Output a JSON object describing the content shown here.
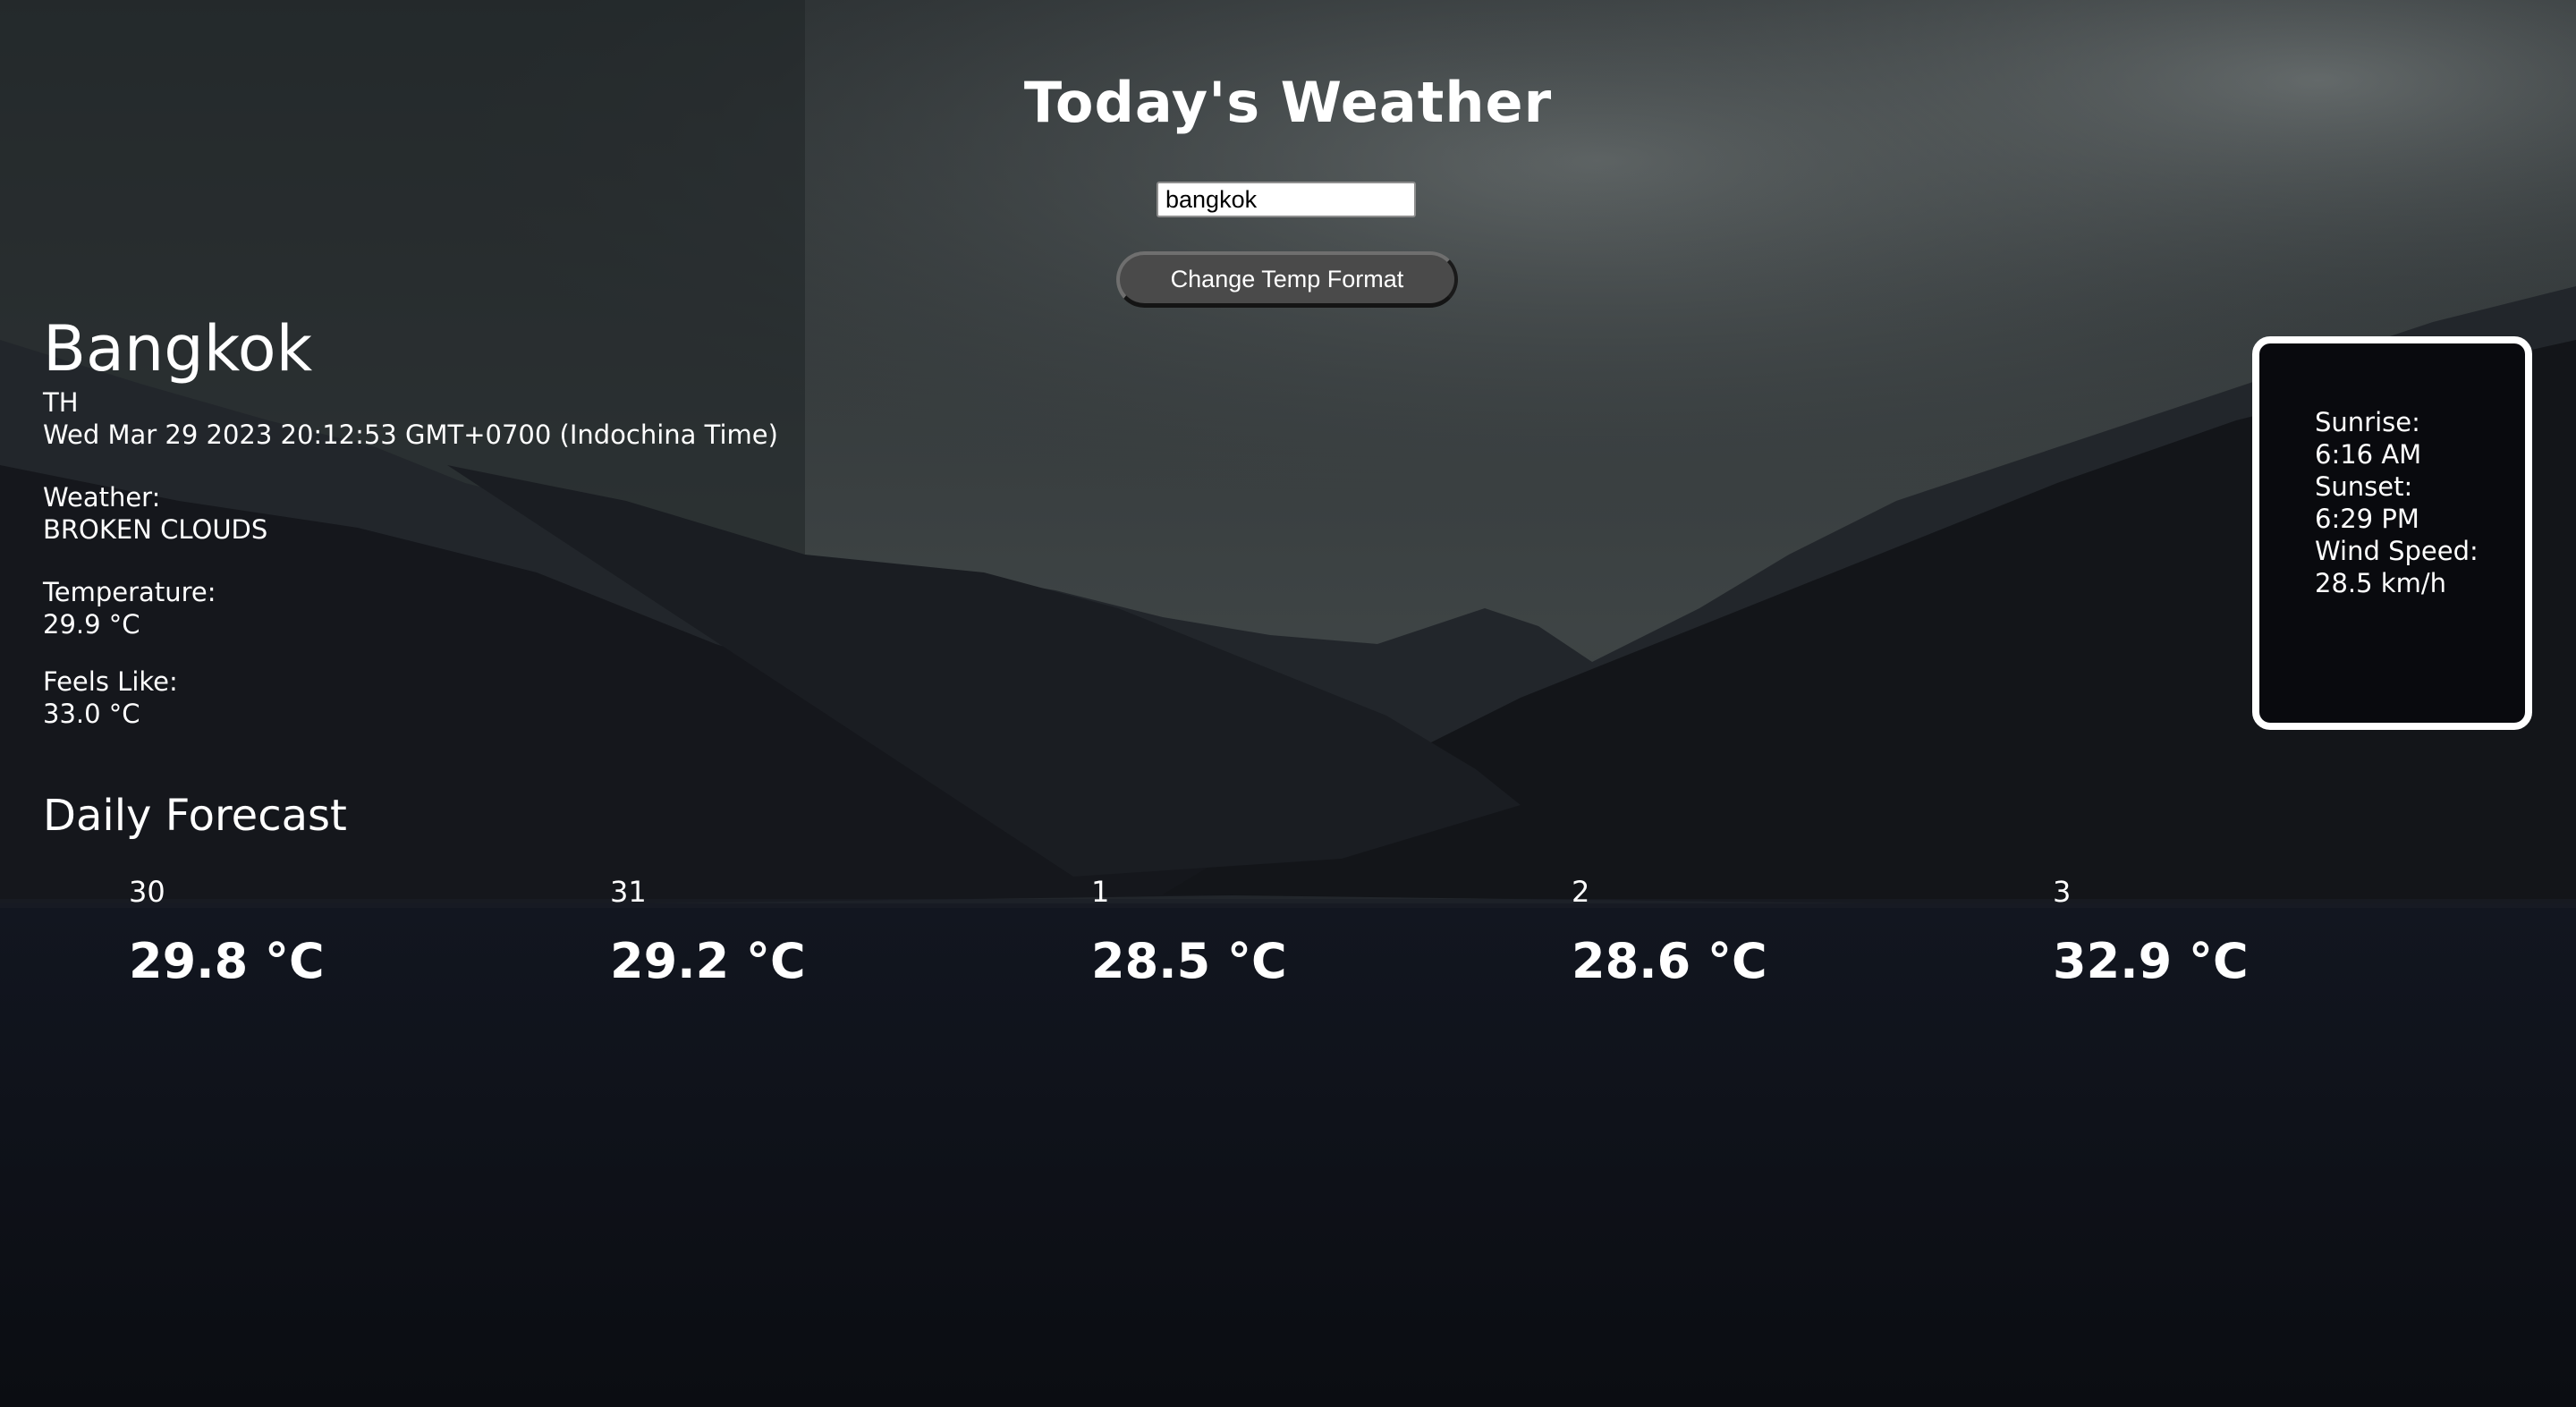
{
  "page": {
    "title": "Today's Weather"
  },
  "search": {
    "value": "bangkok"
  },
  "toolbar": {
    "temp_format_label": "Change Temp Format"
  },
  "current": {
    "city": "Bangkok",
    "country": "TH",
    "datetime": "Wed Mar 29 2023 20:12:53 GMT+0700 (Indochina Time)",
    "weather_label": "Weather:",
    "weather_value": "BROKEN CLOUDS",
    "temperature_label": "Temperature:",
    "temperature_value": "29.9 °C",
    "feels_like_label": "Feels Like:",
    "feels_like_value": "33.0 °C"
  },
  "details": {
    "sunrise_label": "Sunrise:",
    "sunrise_value": "6:16 AM",
    "sunset_label": "Sunset:",
    "sunset_value": "6:29 PM",
    "wind_label": "Wind Speed:",
    "wind_value": "28.5 km/h"
  },
  "forecast": {
    "title": "Daily Forecast",
    "items": [
      {
        "day": "30",
        "temp": "29.8 °C"
      },
      {
        "day": "31",
        "temp": "29.2 °C"
      },
      {
        "day": "1",
        "temp": "28.5 °C"
      },
      {
        "day": "2",
        "temp": "28.6 °C"
      },
      {
        "day": "3",
        "temp": "32.9 °C"
      }
    ]
  },
  "colors": {
    "text": "#ffffff",
    "box_border": "#ffffff",
    "box_background": "#090a0e",
    "button_background": "#4a4a4a"
  }
}
